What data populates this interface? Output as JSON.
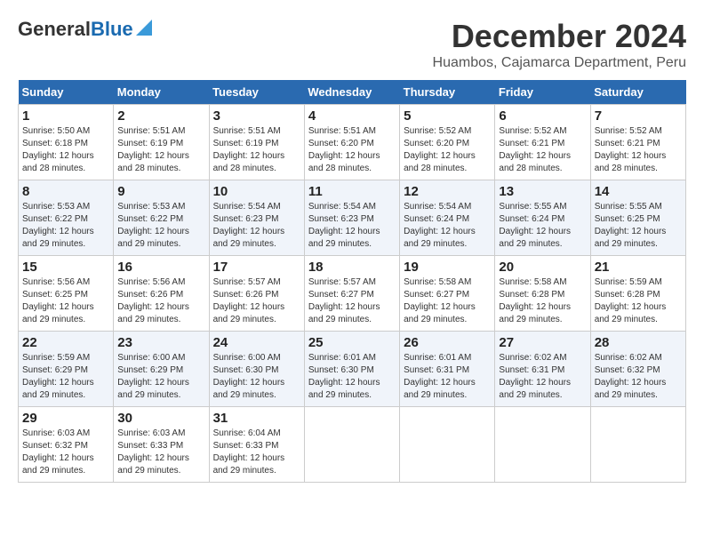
{
  "header": {
    "logo_general": "General",
    "logo_blue": "Blue",
    "month_title": "December 2024",
    "location": "Huambos, Cajamarca Department, Peru"
  },
  "days_of_week": [
    "Sunday",
    "Monday",
    "Tuesday",
    "Wednesday",
    "Thursday",
    "Friday",
    "Saturday"
  ],
  "weeks": [
    [
      {
        "day": "1",
        "info": "Sunrise: 5:50 AM\nSunset: 6:18 PM\nDaylight: 12 hours\nand 28 minutes."
      },
      {
        "day": "2",
        "info": "Sunrise: 5:51 AM\nSunset: 6:19 PM\nDaylight: 12 hours\nand 28 minutes."
      },
      {
        "day": "3",
        "info": "Sunrise: 5:51 AM\nSunset: 6:19 PM\nDaylight: 12 hours\nand 28 minutes."
      },
      {
        "day": "4",
        "info": "Sunrise: 5:51 AM\nSunset: 6:20 PM\nDaylight: 12 hours\nand 28 minutes."
      },
      {
        "day": "5",
        "info": "Sunrise: 5:52 AM\nSunset: 6:20 PM\nDaylight: 12 hours\nand 28 minutes."
      },
      {
        "day": "6",
        "info": "Sunrise: 5:52 AM\nSunset: 6:21 PM\nDaylight: 12 hours\nand 28 minutes."
      },
      {
        "day": "7",
        "info": "Sunrise: 5:52 AM\nSunset: 6:21 PM\nDaylight: 12 hours\nand 28 minutes."
      }
    ],
    [
      {
        "day": "8",
        "info": "Sunrise: 5:53 AM\nSunset: 6:22 PM\nDaylight: 12 hours\nand 29 minutes."
      },
      {
        "day": "9",
        "info": "Sunrise: 5:53 AM\nSunset: 6:22 PM\nDaylight: 12 hours\nand 29 minutes."
      },
      {
        "day": "10",
        "info": "Sunrise: 5:54 AM\nSunset: 6:23 PM\nDaylight: 12 hours\nand 29 minutes."
      },
      {
        "day": "11",
        "info": "Sunrise: 5:54 AM\nSunset: 6:23 PM\nDaylight: 12 hours\nand 29 minutes."
      },
      {
        "day": "12",
        "info": "Sunrise: 5:54 AM\nSunset: 6:24 PM\nDaylight: 12 hours\nand 29 minutes."
      },
      {
        "day": "13",
        "info": "Sunrise: 5:55 AM\nSunset: 6:24 PM\nDaylight: 12 hours\nand 29 minutes."
      },
      {
        "day": "14",
        "info": "Sunrise: 5:55 AM\nSunset: 6:25 PM\nDaylight: 12 hours\nand 29 minutes."
      }
    ],
    [
      {
        "day": "15",
        "info": "Sunrise: 5:56 AM\nSunset: 6:25 PM\nDaylight: 12 hours\nand 29 minutes."
      },
      {
        "day": "16",
        "info": "Sunrise: 5:56 AM\nSunset: 6:26 PM\nDaylight: 12 hours\nand 29 minutes."
      },
      {
        "day": "17",
        "info": "Sunrise: 5:57 AM\nSunset: 6:26 PM\nDaylight: 12 hours\nand 29 minutes."
      },
      {
        "day": "18",
        "info": "Sunrise: 5:57 AM\nSunset: 6:27 PM\nDaylight: 12 hours\nand 29 minutes."
      },
      {
        "day": "19",
        "info": "Sunrise: 5:58 AM\nSunset: 6:27 PM\nDaylight: 12 hours\nand 29 minutes."
      },
      {
        "day": "20",
        "info": "Sunrise: 5:58 AM\nSunset: 6:28 PM\nDaylight: 12 hours\nand 29 minutes."
      },
      {
        "day": "21",
        "info": "Sunrise: 5:59 AM\nSunset: 6:28 PM\nDaylight: 12 hours\nand 29 minutes."
      }
    ],
    [
      {
        "day": "22",
        "info": "Sunrise: 5:59 AM\nSunset: 6:29 PM\nDaylight: 12 hours\nand 29 minutes."
      },
      {
        "day": "23",
        "info": "Sunrise: 6:00 AM\nSunset: 6:29 PM\nDaylight: 12 hours\nand 29 minutes."
      },
      {
        "day": "24",
        "info": "Sunrise: 6:00 AM\nSunset: 6:30 PM\nDaylight: 12 hours\nand 29 minutes."
      },
      {
        "day": "25",
        "info": "Sunrise: 6:01 AM\nSunset: 6:30 PM\nDaylight: 12 hours\nand 29 minutes."
      },
      {
        "day": "26",
        "info": "Sunrise: 6:01 AM\nSunset: 6:31 PM\nDaylight: 12 hours\nand 29 minutes."
      },
      {
        "day": "27",
        "info": "Sunrise: 6:02 AM\nSunset: 6:31 PM\nDaylight: 12 hours\nand 29 minutes."
      },
      {
        "day": "28",
        "info": "Sunrise: 6:02 AM\nSunset: 6:32 PM\nDaylight: 12 hours\nand 29 minutes."
      }
    ],
    [
      {
        "day": "29",
        "info": "Sunrise: 6:03 AM\nSunset: 6:32 PM\nDaylight: 12 hours\nand 29 minutes."
      },
      {
        "day": "30",
        "info": "Sunrise: 6:03 AM\nSunset: 6:33 PM\nDaylight: 12 hours\nand 29 minutes."
      },
      {
        "day": "31",
        "info": "Sunrise: 6:04 AM\nSunset: 6:33 PM\nDaylight: 12 hours\nand 29 minutes."
      },
      null,
      null,
      null,
      null
    ]
  ]
}
